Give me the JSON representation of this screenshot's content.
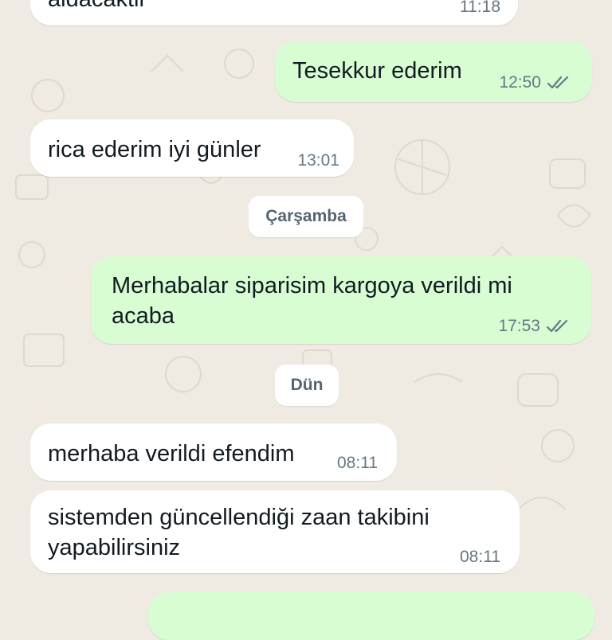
{
  "messages": [
    {
      "direction": "incoming",
      "text": "aldacaktir",
      "time": "11:18"
    },
    {
      "direction": "outgoing",
      "text": "Tesekkur ederim",
      "time": "12:50",
      "status_icon": "read-double-check-icon"
    },
    {
      "direction": "incoming",
      "text": "rica ederim iyi günler",
      "time": "13:01"
    },
    {
      "direction": "outgoing",
      "lines": [
        "Merhabalar siparisim kargoya  verildi mi",
        "acaba"
      ],
      "time": "17:53",
      "status_icon": "read-double-check-icon"
    },
    {
      "direction": "incoming",
      "text": "merhaba verildi efendim",
      "time": "08:11"
    },
    {
      "direction": "incoming",
      "lines": [
        "sistemden güncellendiği zaan takibini",
        "yapabilirsiniz"
      ],
      "time": "08:11"
    }
  ],
  "date_dividers": [
    "Çarşamba",
    "Dün"
  ],
  "colors": {
    "background": "#efeae2",
    "incoming_bubble": "#ffffff",
    "outgoing_bubble": "#d9fdd3",
    "timestamp": "#667781",
    "read_ticks": "#667781"
  }
}
